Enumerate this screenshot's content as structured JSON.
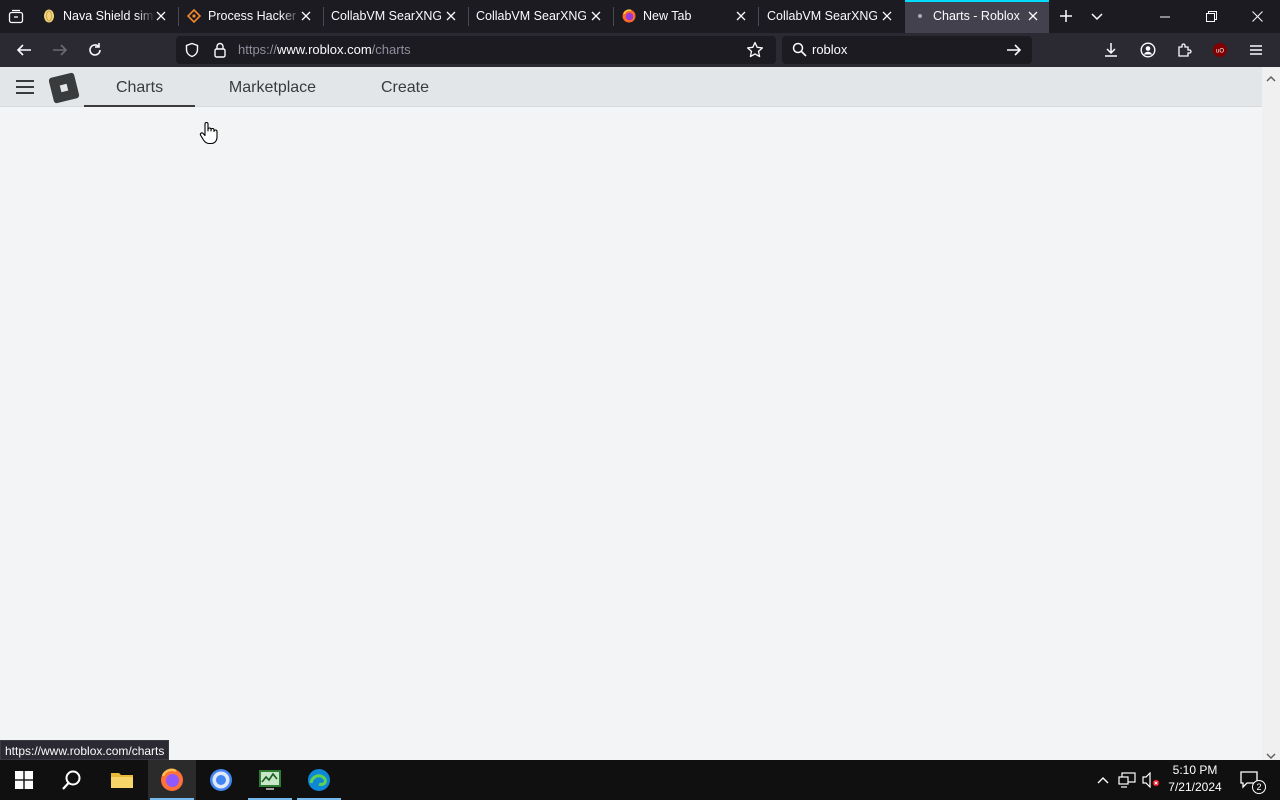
{
  "browser": {
    "tabs": [
      {
        "title": "Nava Shield simulator",
        "icon": "lemon-favicon-icon",
        "active": false
      },
      {
        "title": "Process Hacker download",
        "icon": "process-hacker-favicon-icon",
        "active": false
      },
      {
        "title": "CollabVM SearXNG",
        "icon": "none",
        "active": false
      },
      {
        "title": "CollabVM SearXNG",
        "icon": "none",
        "active": false
      },
      {
        "title": "New Tab",
        "icon": "firefox-favicon-icon",
        "active": false
      },
      {
        "title": "CollabVM SearXNG",
        "icon": "none",
        "active": false
      },
      {
        "title": "Charts - Roblox",
        "icon": "loading-dot-icon",
        "active": true
      }
    ],
    "url": {
      "scheme": "https://",
      "host": "www.roblox.com",
      "path": "/charts"
    },
    "search_value": "roblox",
    "status_link": "https://www.roblox.com/charts",
    "accent_color": "#00ddff"
  },
  "roblox": {
    "nav_tabs": [
      {
        "label": "Charts",
        "active": true
      },
      {
        "label": "Marketplace",
        "active": false
      },
      {
        "label": "Create",
        "active": false
      }
    ]
  },
  "taskbar": {
    "apps": [
      "start-icon",
      "search-icon",
      "file-explorer-icon",
      "firefox-icon",
      "chrome-icon",
      "task-manager-icon",
      "edge-icon"
    ],
    "time": "5:10 PM",
    "date": "7/21/2024",
    "notification_count": "2"
  }
}
